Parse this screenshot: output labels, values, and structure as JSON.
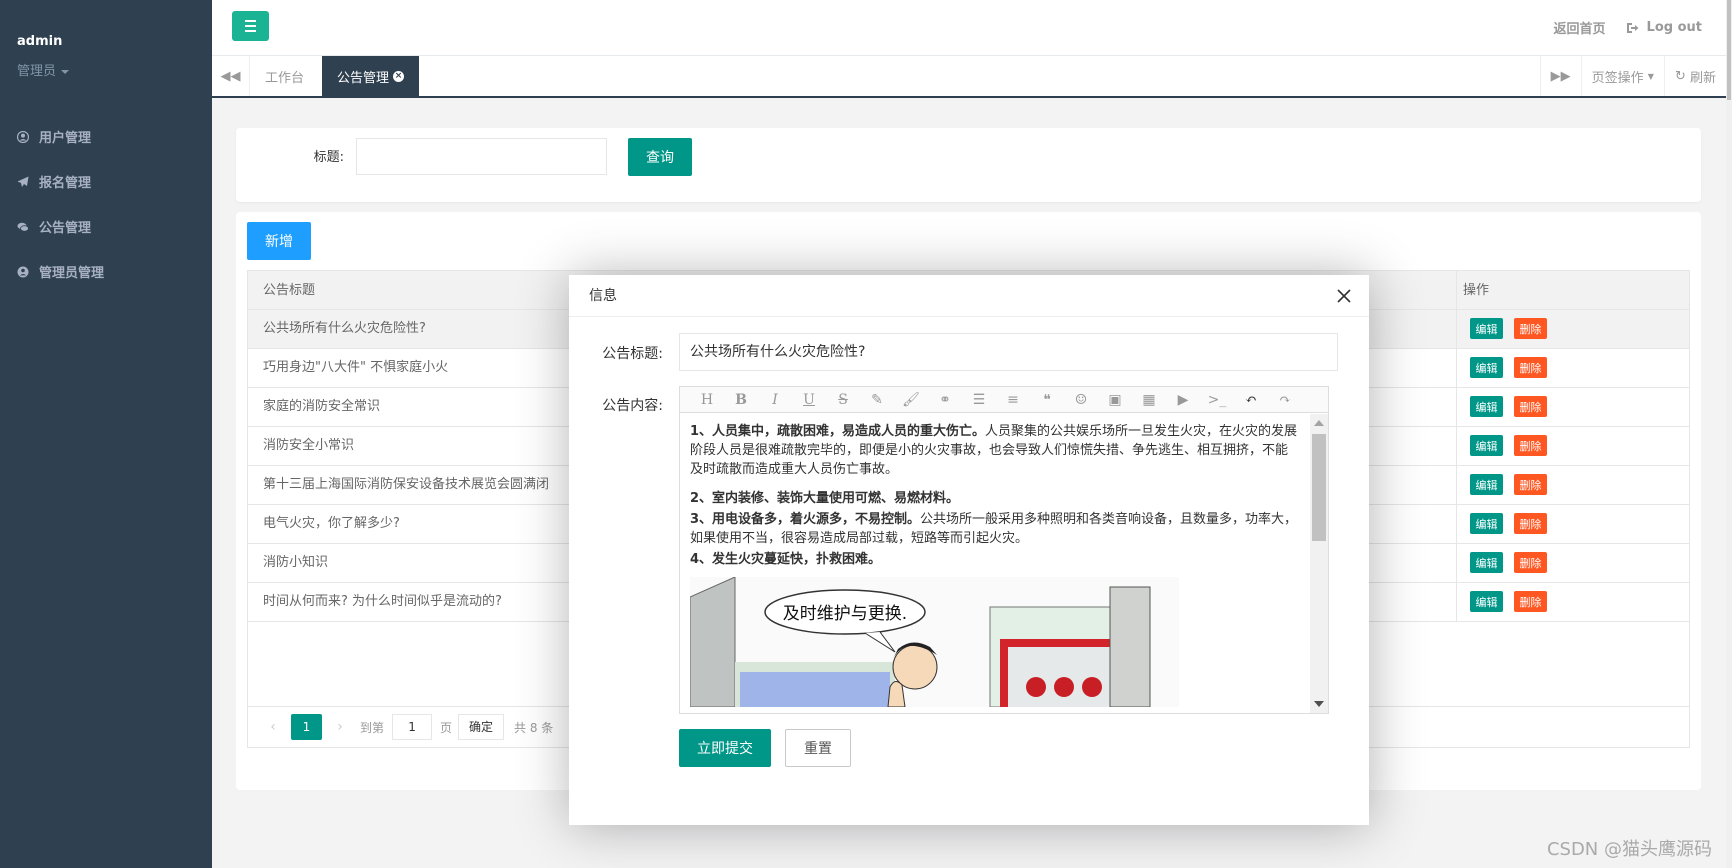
{
  "sidebar": {
    "user": "admin",
    "role": "管理员",
    "items": [
      {
        "label": "用户管理",
        "icon": "user-icon"
      },
      {
        "label": "报名管理",
        "icon": "paper-plane-icon"
      },
      {
        "label": "公告管理",
        "icon": "comments-icon"
      },
      {
        "label": "管理员管理",
        "icon": "user-circle-icon"
      }
    ]
  },
  "topbar": {
    "home": "返回首页",
    "logout": "Log out"
  },
  "tabs": {
    "items": [
      "工作台",
      "公告管理"
    ],
    "tab_ops": "页签操作",
    "refresh": "刷新"
  },
  "search": {
    "label": "标题:",
    "placeholder": "",
    "query_btn": "查询"
  },
  "table": {
    "add_btn": "新增",
    "col_title": "公告标题",
    "col_ops": "操作",
    "edit": "编辑",
    "delete": "删除",
    "rows": [
      "公共场所有什么火灾危险性?",
      "巧用身边\"八大件\" 不惧家庭小火",
      "家庭的消防安全常识",
      "消防安全小常识",
      "第十三届上海国际消防保安设备技术展览会圆满闭",
      "电气火灾，你了解多少?",
      "消防小知识",
      "时间从何而来? 为什么时间似乎是流动的?"
    ]
  },
  "pager": {
    "current": "1",
    "goto": "到第",
    "page_input": "1",
    "page_unit": "页",
    "confirm": "确定",
    "total": "共 8 条"
  },
  "modal": {
    "title": "信息",
    "field_title_label": "公告标题:",
    "field_title_value": "公共场所有什么火灾危险性?",
    "field_content_label": "公告内容:",
    "p1_bold": "1、人员集中，疏散困难，易造成人员的重大伤亡。",
    "p1_rest": "人员聚集的公共娱乐场所一旦发生火灾，在火灾的发展阶段人员是很难疏散完毕的，即便是小的火灾事故，也会导致人们惊慌失措、争先逃生、相互拥挤，不能及时疏散而造成重大人员伤亡事故。",
    "p2_bold": "2、室内装修、装饰大量使用可燃、易燃材料。",
    "p3_bold": "3、用电设备多，着火源多，不易控制。",
    "p3_rest": "公共场所一般采用多种照明和各类音响设备，且数量多，功率大，如果使用不当，很容易造成局部过载，短路等而引起火灾。",
    "p4_bold": "4、发生火灾蔓延快，扑救困难。",
    "cartoon_bubble": "及时维护与更换.",
    "submit": "立即提交",
    "reset": "重置"
  },
  "watermark": "CSDN @猫头鹰源码"
}
